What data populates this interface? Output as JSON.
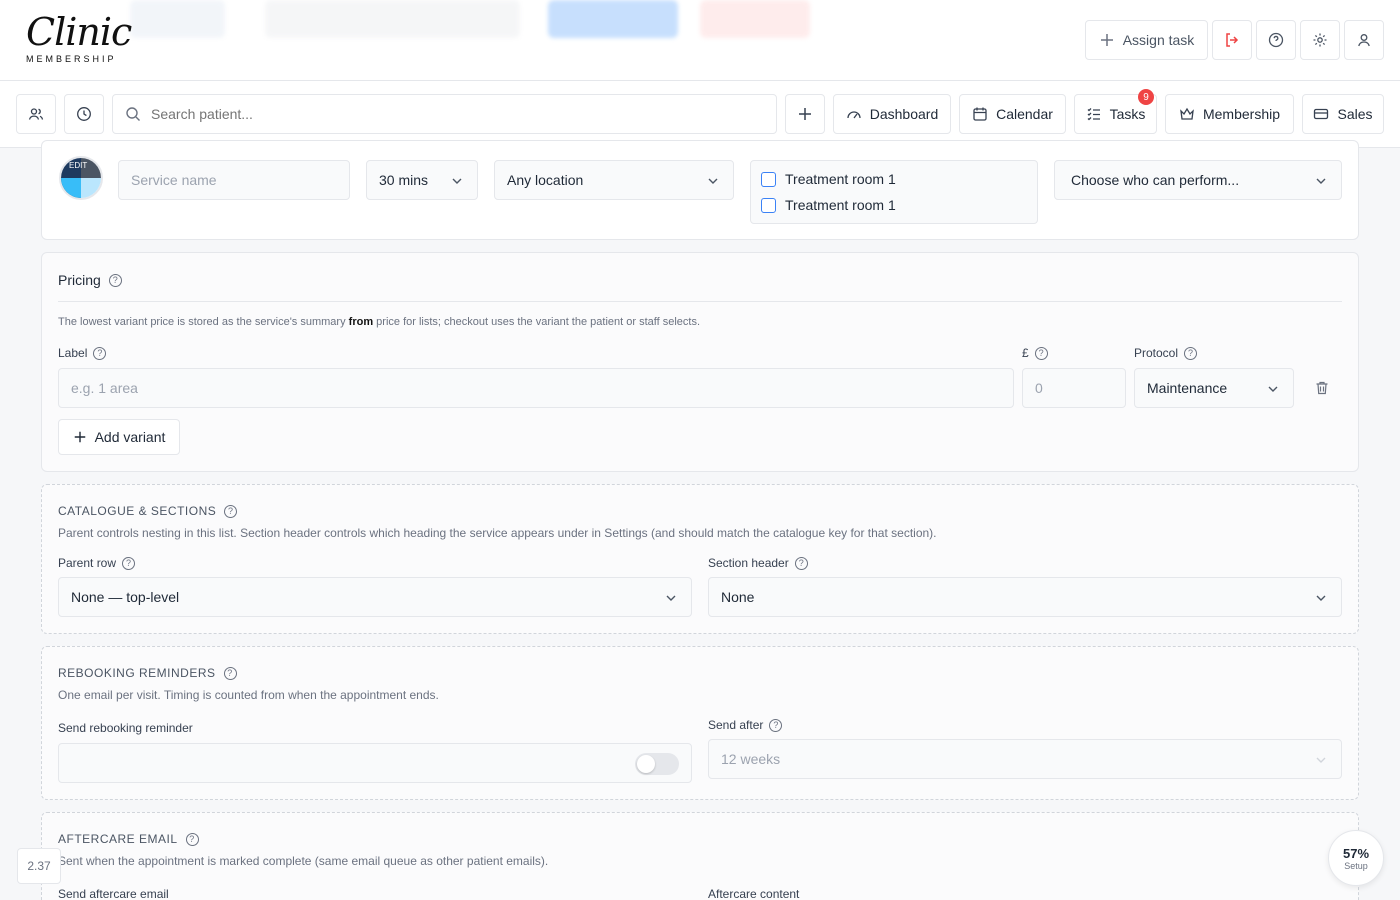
{
  "header": {
    "logo_script": "Clinic",
    "logo_sub": "MEMBERSHIP",
    "assign_task_label": "Assign task"
  },
  "nav": {
    "search_placeholder": "Search patient...",
    "dashboard": "Dashboard",
    "calendar": "Calendar",
    "tasks": "Tasks",
    "tasks_badge": "9",
    "membership": "Membership",
    "sales": "Sales"
  },
  "service": {
    "avatar_edit": "EDIT",
    "name_placeholder": "Service name",
    "duration": "30 mins",
    "location": "Any location",
    "rooms": [
      "Treatment room 1",
      "Treatment room 1"
    ],
    "performers_placeholder": "Choose who can perform..."
  },
  "pricing": {
    "title": "Pricing",
    "desc_before": "The lowest variant price is stored as the service's summary ",
    "desc_bold": "from",
    "desc_after": " price for lists; checkout uses the variant the patient or staff selects.",
    "label_label": "Label",
    "currency_label": "£",
    "protocol_label": "Protocol",
    "label_placeholder": "e.g. 1 area",
    "price_placeholder": "0",
    "protocol_value": "Maintenance",
    "add_variant": "Add variant"
  },
  "catalogue": {
    "title": "CATALOGUE & SECTIONS",
    "desc": "Parent controls nesting in this list. Section header controls which heading the service appears under in Settings (and should match the catalogue key for that section).",
    "parent_label": "Parent row",
    "parent_value": "None — top-level",
    "section_label": "Section header",
    "section_value": "None"
  },
  "rebooking": {
    "title": "REBOOKING REMINDERS",
    "desc": "One email per visit. Timing is counted from when the appointment ends.",
    "send_label": "Send rebooking reminder",
    "after_label": "Send after",
    "after_value": "12 weeks"
  },
  "aftercare": {
    "title": "AFTERCARE EMAIL",
    "desc": "Sent when the appointment is marked complete (same email queue as other patient emails).",
    "send_label": "Send aftercare email",
    "content_label": "Aftercare content"
  },
  "footer": {
    "version": "2.37",
    "setup_pct": "57%",
    "setup_label": "Setup"
  }
}
